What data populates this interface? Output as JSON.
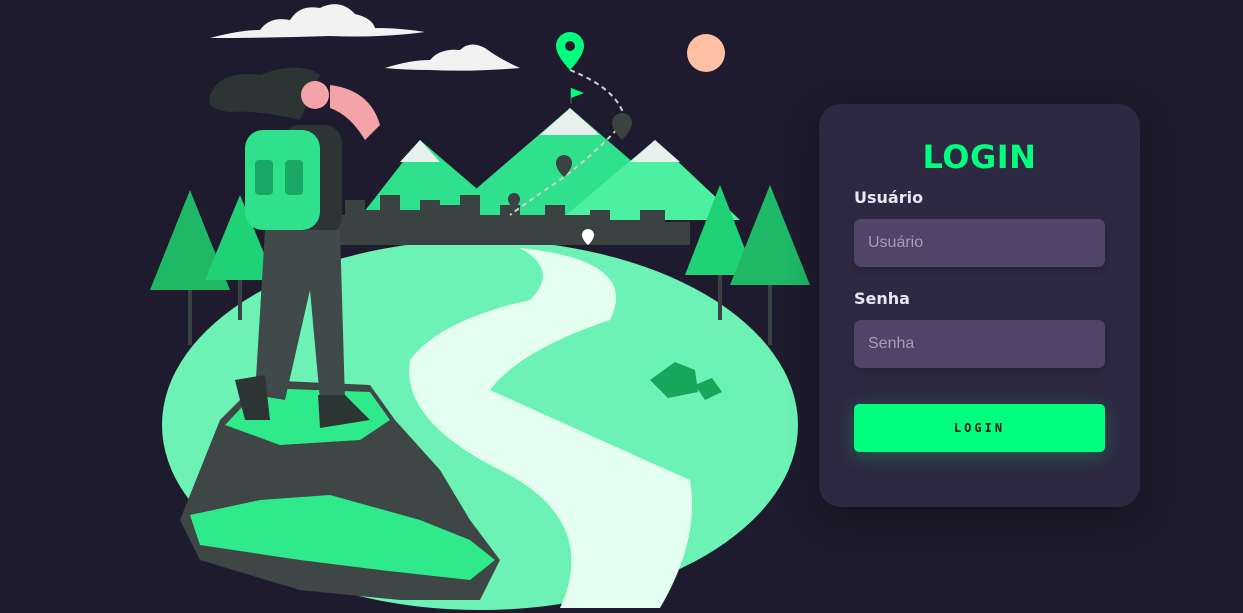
{
  "login": {
    "title": "LOGIN",
    "username_label": "Usuário",
    "username_placeholder": "Usuário",
    "password_label": "Senha",
    "password_placeholder": "Senha",
    "button_label": "LOGIN"
  },
  "colors": {
    "background": "#1f1b2e",
    "card": "#2e2942",
    "accent": "#00ff7f",
    "input": "#514567"
  },
  "illustration": {
    "icons": [
      "cloud-icon",
      "location-pin-icon",
      "sun-icon",
      "mountain-icon",
      "tree-icon",
      "flag-icon",
      "hiker-illustration",
      "rock-icon",
      "path-icon"
    ]
  }
}
